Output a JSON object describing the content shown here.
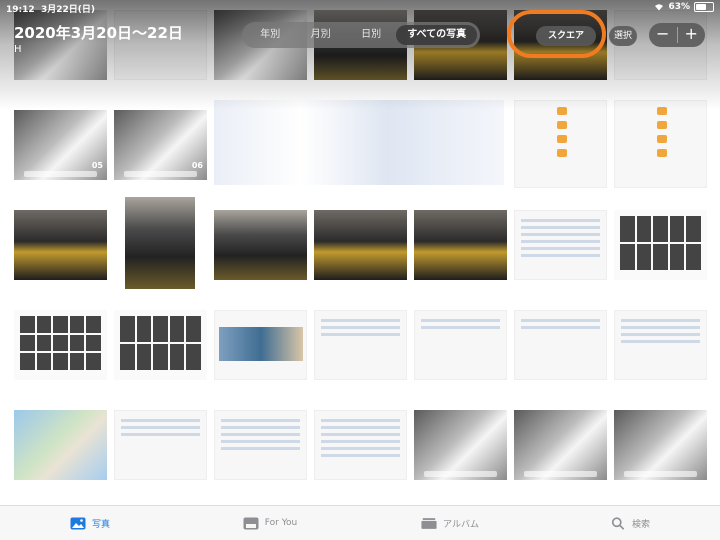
{
  "status_bar": {
    "time": "19:12",
    "date": "3月22日(日)",
    "battery": "63%",
    "battery_level": 0.63
  },
  "header": {
    "title": "2020年3月20日～22日",
    "subtitle": "H",
    "segments": [
      "年別",
      "月別",
      "日別",
      "すべての写真"
    ],
    "selected_segment": "すべての写真",
    "square_label": "スクエア",
    "select_label": "選択",
    "zoom_out": "−",
    "zoom_in": "+"
  },
  "highlight": {
    "target": "square-button",
    "color": "#f07b20"
  },
  "thumbnails": {
    "row1_badge_a": "05",
    "row1_badge_b": "06"
  },
  "tab_bar": {
    "tabs": [
      {
        "label": "写真",
        "icon": "photos-icon",
        "active": true
      },
      {
        "label": "For You",
        "icon": "for-you-icon",
        "active": false
      },
      {
        "label": "アルバム",
        "icon": "albums-icon",
        "active": false
      },
      {
        "label": "検索",
        "icon": "search-icon",
        "active": false
      }
    ],
    "active_color": "#1f7ae0"
  }
}
